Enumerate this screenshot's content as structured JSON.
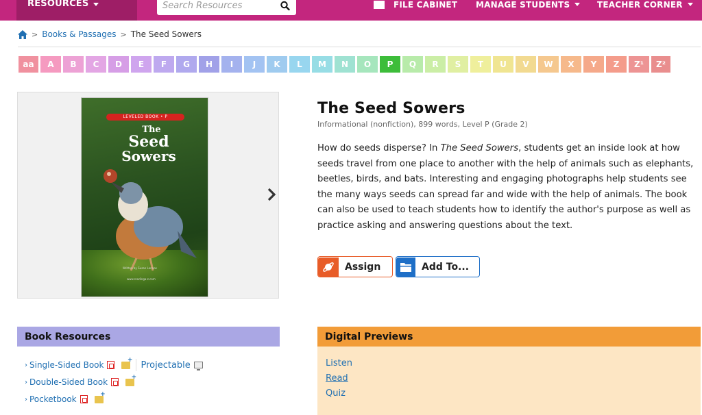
{
  "topbar": {
    "resources_label": "RESOURCES",
    "search_placeholder": "Search Resources",
    "nav": [
      {
        "label": "FILE CABINET"
      },
      {
        "label": "MANAGE STUDENTS"
      },
      {
        "label": "TEACHER CORNER"
      }
    ]
  },
  "breadcrumb": {
    "parent": "Books & Passages",
    "current": "The Seed Sowers"
  },
  "levels": [
    {
      "label": "aa",
      "color": "#f0919f",
      "w": 29
    },
    {
      "label": "A",
      "color": "#f59ac0",
      "w": 30
    },
    {
      "label": "B",
      "color": "#eda2d5",
      "w": 30
    },
    {
      "label": "C",
      "color": "#e3a6e4",
      "w": 30
    },
    {
      "label": "D",
      "color": "#d69ee6",
      "w": 30
    },
    {
      "label": "E",
      "color": "#cfa5ee",
      "w": 30
    },
    {
      "label": "F",
      "color": "#bea9ef",
      "w": 30
    },
    {
      "label": "G",
      "color": "#b0a9ee",
      "w": 30
    },
    {
      "label": "H",
      "color": "#a1a1e8",
      "w": 30
    },
    {
      "label": "I",
      "color": "#a4b2ee",
      "w": 30
    },
    {
      "label": "J",
      "color": "#a3c3f2",
      "w": 30
    },
    {
      "label": "K",
      "color": "#9fcbef",
      "w": 30
    },
    {
      "label": "L",
      "color": "#98d6ef",
      "w": 30
    },
    {
      "label": "M",
      "color": "#97dde5",
      "w": 30
    },
    {
      "label": "N",
      "color": "#9fe2d2",
      "w": 30
    },
    {
      "label": "O",
      "color": "#a6e6bd",
      "w": 30
    },
    {
      "label": "P",
      "color": "#3dbd3a",
      "w": 30
    },
    {
      "label": "Q",
      "color": "#b8ebaa",
      "w": 30
    },
    {
      "label": "R",
      "color": "#cbeea6",
      "w": 30
    },
    {
      "label": "S",
      "color": "#e0efa2",
      "w": 30
    },
    {
      "label": "T",
      "color": "#efef9c",
      "w": 30
    },
    {
      "label": "U",
      "color": "#f0e592",
      "w": 30
    },
    {
      "label": "V",
      "color": "#f2da91",
      "w": 30
    },
    {
      "label": "W",
      "color": "#f5c88f",
      "w": 30
    },
    {
      "label": "X",
      "color": "#f6b98b",
      "w": 30
    },
    {
      "label": "Y",
      "color": "#f5a98a",
      "w": 30
    },
    {
      "label": "Z",
      "color": "#f49c8b",
      "w": 30
    },
    {
      "label": "Z¹",
      "color": "#ed9494",
      "w": 30
    },
    {
      "label": "Z²",
      "color": "#e98e8e",
      "w": 28
    }
  ],
  "book": {
    "title": "The Seed Sowers",
    "subtitle": "Informational (nonfiction), 899 words, Level P (Grade 2)",
    "desc_before": "How do seeds disperse? In ",
    "desc_italic": "The Seed Sowers",
    "desc_after": ", students get an inside look at how seeds travel from one place to another with the help of animals such as elephants, beetles, birds, and bats. Interesting and engaging photographs help students see the many ways seeds can spread far and wide with the help of animals. The book can also be used to teach students how to identify the author's purpose as well as practice asking and answering questions about the text.",
    "assign_label": "Assign",
    "addto_label": "Add To..."
  },
  "cover": {
    "band": "LEVELED BOOK • P",
    "t1": "The",
    "t2": "Seed",
    "t3": "Sowers",
    "author": "Written by Susan Lennox",
    "site": "www.readinga-z.com"
  },
  "book_resources": {
    "heading": "Book Resources",
    "items": [
      {
        "label": "Single-Sided Book"
      },
      {
        "label": "Double-Sided Book"
      },
      {
        "label": "Pocketbook"
      }
    ],
    "projectable": "Projectable"
  },
  "digital_previews": {
    "heading": "Digital Previews",
    "items": [
      {
        "label": "Listen"
      },
      {
        "label": "Read"
      },
      {
        "label": "Quiz"
      }
    ]
  }
}
